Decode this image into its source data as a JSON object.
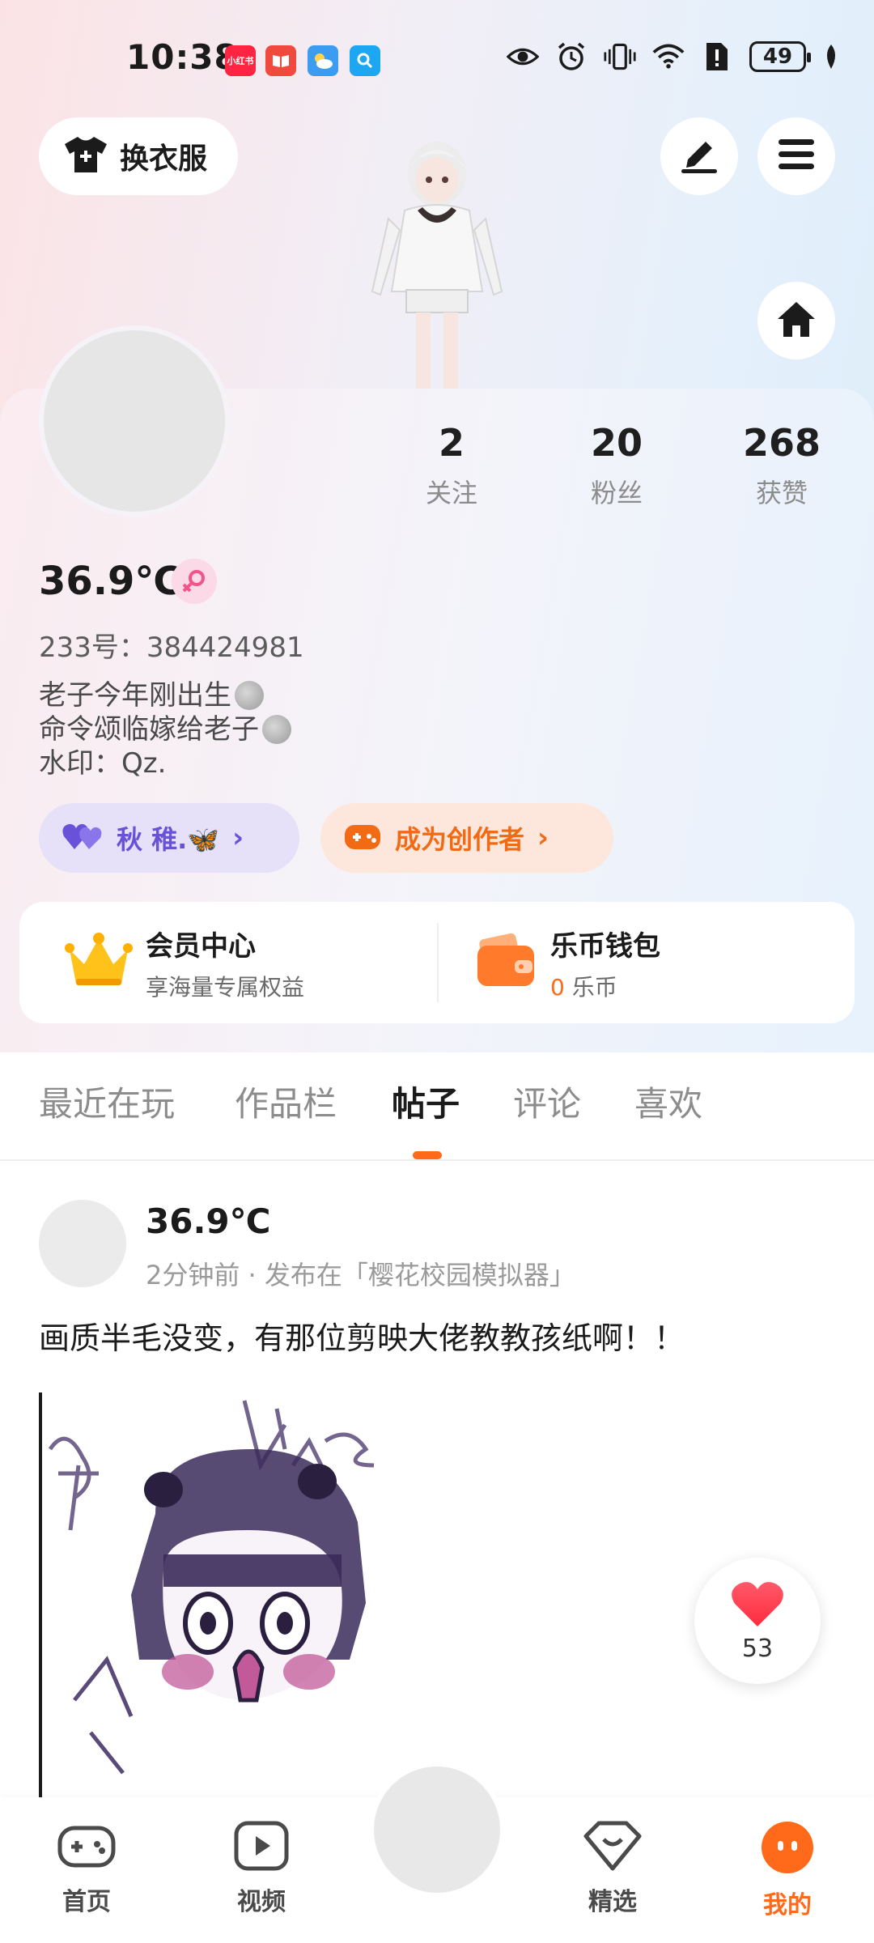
{
  "status_bar": {
    "time": "10:38",
    "app_badges": [
      {
        "name": "xiaohongshu",
        "text": "小红书",
        "color": "#ff2442"
      },
      {
        "name": "book",
        "text": "",
        "color": "#f04a3e"
      },
      {
        "name": "weather",
        "text": "",
        "color": "#3b9cf2"
      },
      {
        "name": "search",
        "text": "",
        "color": "#1da6f2"
      }
    ],
    "battery": "49"
  },
  "header": {
    "outfit_label": "换衣服"
  },
  "profile": {
    "stats": [
      {
        "num": "2",
        "label": "关注"
      },
      {
        "num": "20",
        "label": "粉丝"
      },
      {
        "num": "268",
        "label": "获赞"
      }
    ],
    "username": "36.9℃",
    "uid": "233号：384424981",
    "bio_lines": [
      "老子今年刚出生",
      "命令颂临嫁给老子",
      "水印：Qz."
    ],
    "tag1": "秋 稚.🦋",
    "tag2": "成为创作者"
  },
  "wallet": {
    "vip_title": "会员中心",
    "vip_sub": "享海量专属权益",
    "coin_title": "乐币钱包",
    "coin_amount": "0",
    "coin_unit": "乐币"
  },
  "tabs": [
    "最近在玩",
    "作品栏",
    "帖子",
    "评论",
    "喜欢"
  ],
  "active_tab": "帖子",
  "post": {
    "author": "36.9℃",
    "meta": "2分钟前 · 发布在「樱花校园模拟器」",
    "text": "画质半毛没变，有那位剪映大佬教教孩纸啊！！",
    "like_count": "53"
  },
  "bottom_nav": [
    "首页",
    "视频",
    "精选",
    "我的"
  ],
  "colors": {
    "accent": "#ff6a1a",
    "tag1_bg": "#e6e1f8",
    "tag1_fg": "#6a52d8",
    "tag2_bg": "#fde7dc",
    "tag2_fg": "#f26a14"
  }
}
